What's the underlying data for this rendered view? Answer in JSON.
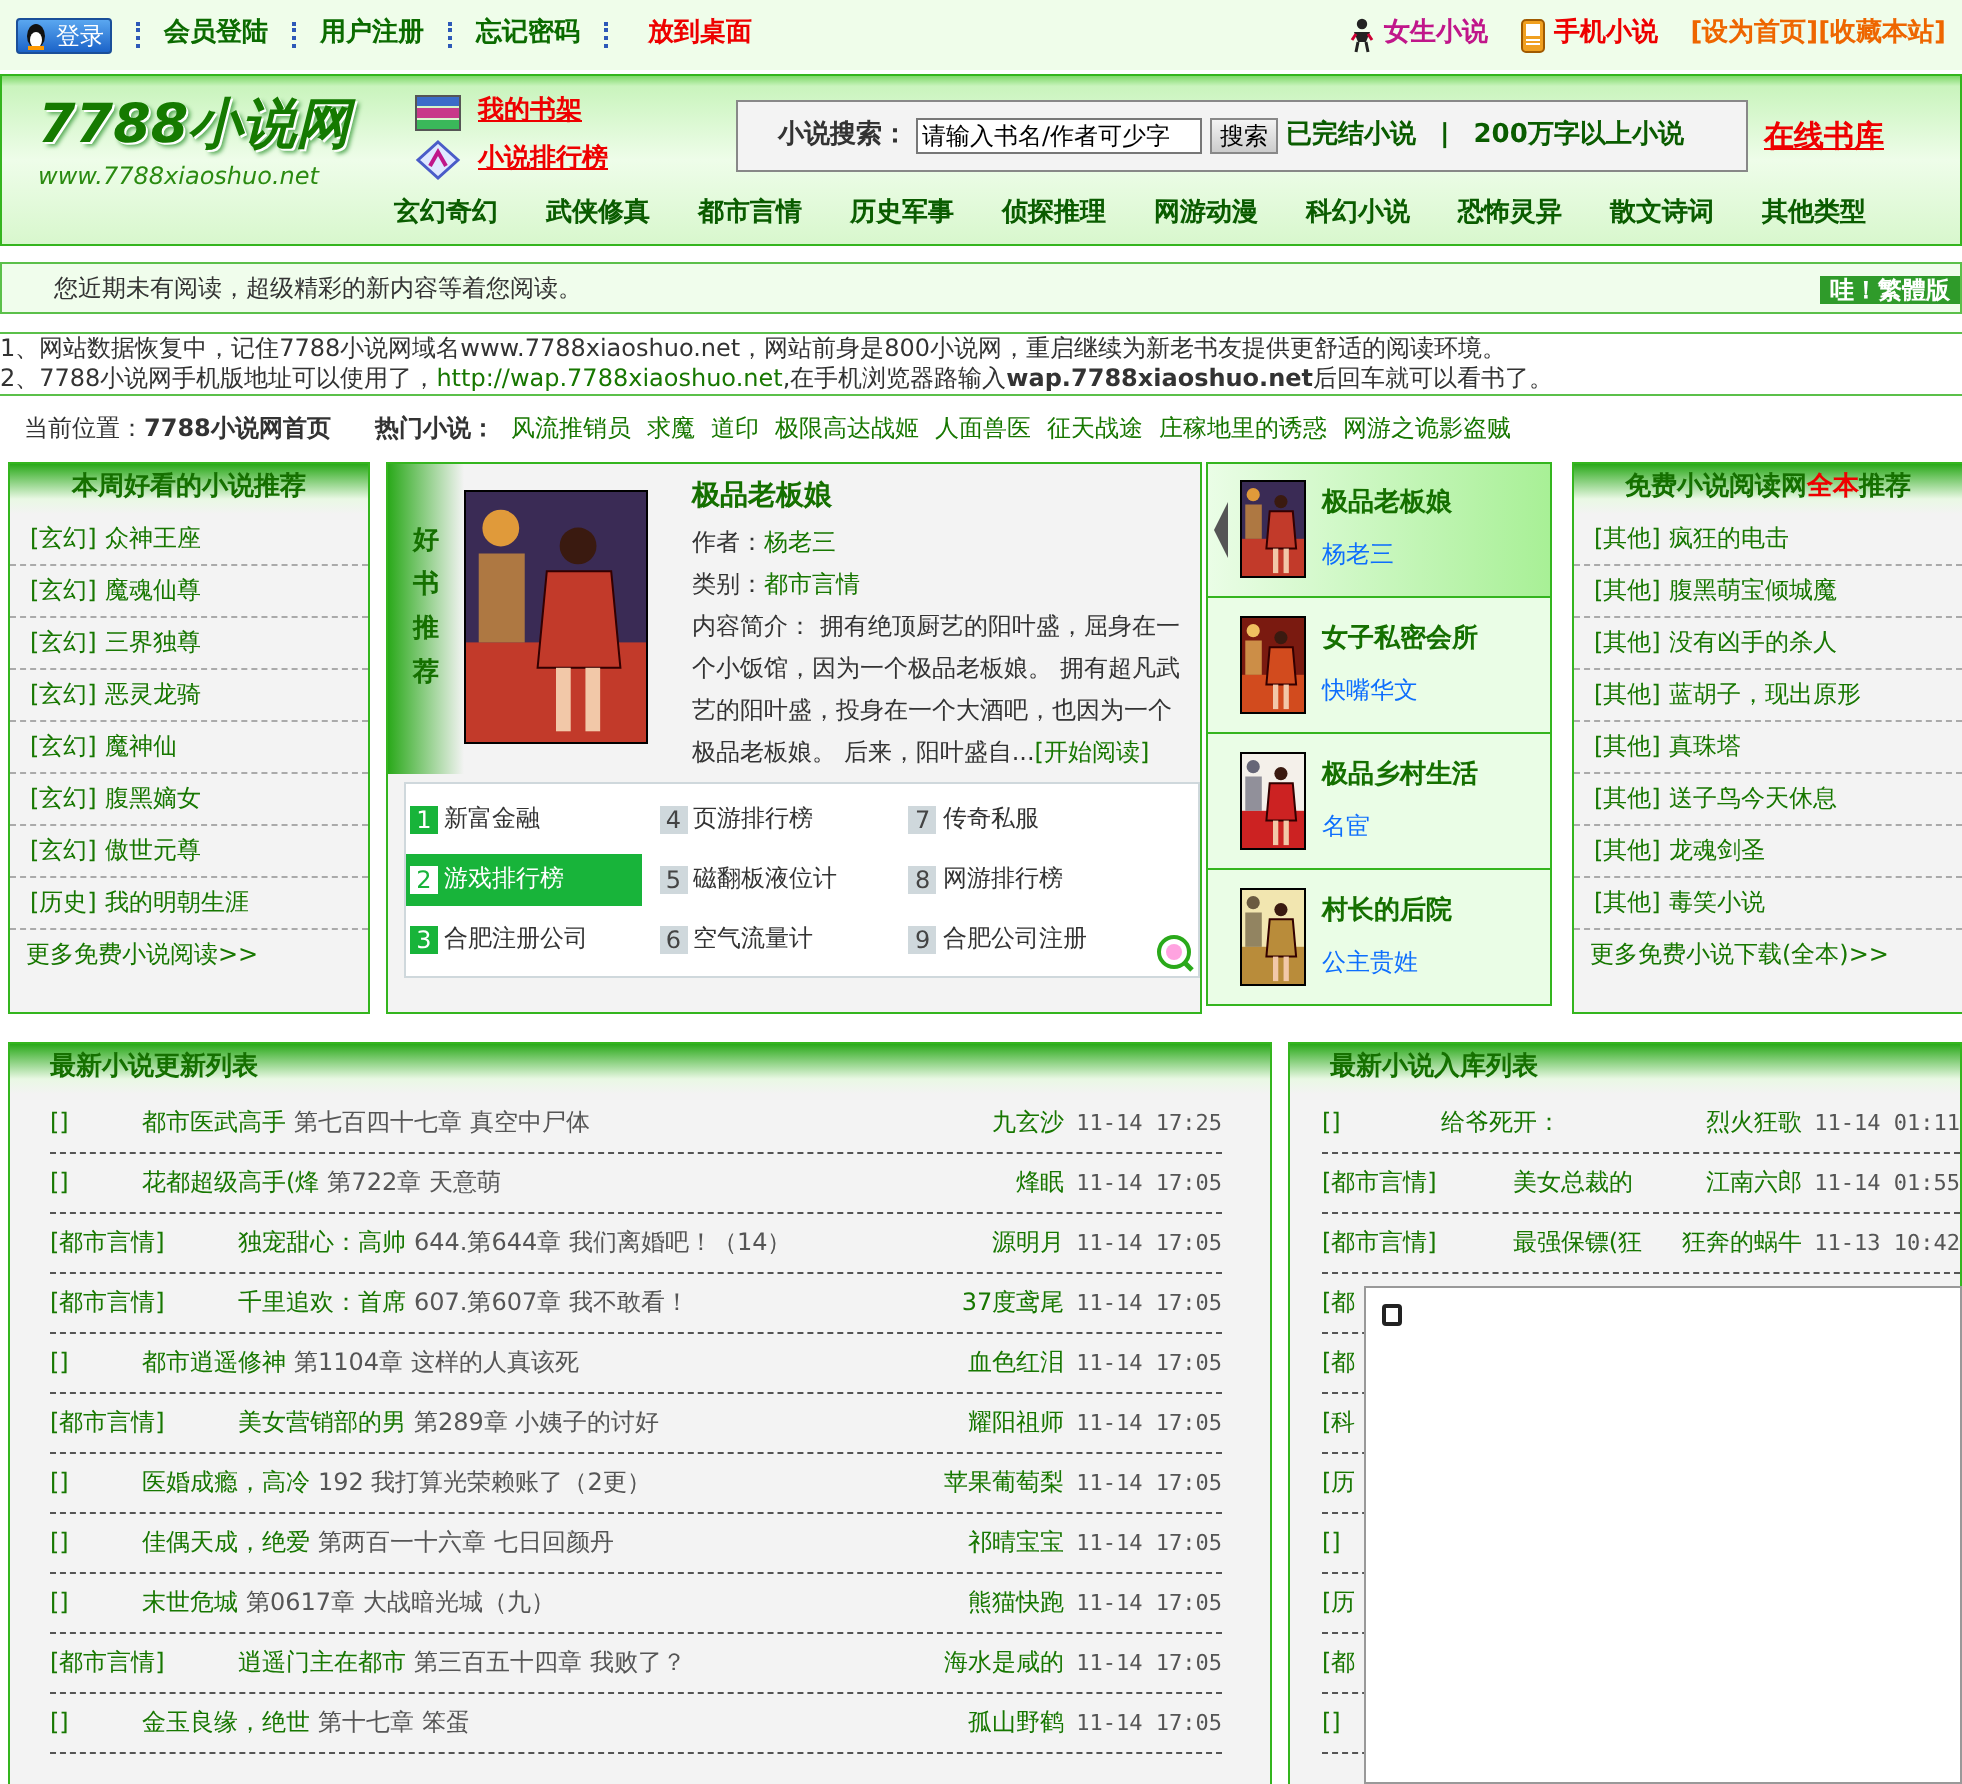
{
  "topbar": {
    "login_button": "登录",
    "links": [
      "会员登陆",
      "用户注册",
      "忘记密码"
    ],
    "desktop_link": "放到桌面",
    "right_links": [
      {
        "kind": "female",
        "label": "女生小说"
      },
      {
        "kind": "mobile",
        "label": "手机小说"
      }
    ],
    "bracket_links": [
      "[设为首页]",
      "[收藏本站]"
    ]
  },
  "header": {
    "logo": "7788小说网",
    "logo_url": "www.7788xiaoshuo.net",
    "quick_links": [
      {
        "kind": "shelf",
        "label": "我的书架"
      },
      {
        "kind": "rank",
        "label": "小说排行榜"
      }
    ],
    "search": {
      "label": "小说搜索：",
      "value": "请输入书名/作者可少字",
      "button": "搜索"
    },
    "search_links": [
      "已完结小说",
      "200万字以上小说"
    ],
    "separator": "|",
    "library_link": "在线书库",
    "categories": [
      "玄幻奇幻",
      "武侠修真",
      "都市言情",
      "历史军事",
      "侦探推理",
      "网游动漫",
      "科幻小说",
      "恐怖灵异",
      "散文诗词",
      "其他类型"
    ]
  },
  "notice": {
    "text": "您近期未有阅读，超级精彩的新内容等着您阅读。",
    "button": "哇！繁體版"
  },
  "announcements": [
    {
      "parts": [
        {
          "kind": "text",
          "text": "1、网站数据恢复中，记住7788小说网域名www.7788xiaoshuo.net，网站前身是800小说网，重启继续为新老书友提供更舒适的阅读环境。"
        }
      ]
    },
    {
      "parts": [
        {
          "kind": "text",
          "text": "2、7788小说网手机版地址可以使用了，"
        },
        {
          "kind": "link",
          "text": "http://wap.7788xiaoshuo.net"
        },
        {
          "kind": "text",
          "text": ",在手机浏览器路输入**wap.7788xiaoshuo.net**后回车就可以看书了。"
        }
      ]
    }
  ],
  "breadcrumb": {
    "label": "当前位置：",
    "current": "7788小说网首页",
    "hot_label": "热门小说：",
    "hot": [
      "风流推销员",
      "求魔",
      "道印",
      "极限高达战姬",
      "人面兽医",
      "征天战途",
      "庄稼地里的诱惑",
      "网游之诡影盗贼"
    ]
  },
  "weekly": {
    "title": "本周好看的小说推荐",
    "items": [
      {
        "cat": "[玄幻]",
        "title": "众神王座"
      },
      {
        "cat": "[玄幻]",
        "title": "魔魂仙尊"
      },
      {
        "cat": "[玄幻]",
        "title": "三界独尊"
      },
      {
        "cat": "[玄幻]",
        "title": "恶灵龙骑"
      },
      {
        "cat": "[玄幻]",
        "title": "魔神仙"
      },
      {
        "cat": "[玄幻]",
        "title": "腹黑嫡女"
      },
      {
        "cat": "[玄幻]",
        "title": "傲世元尊"
      },
      {
        "cat": "[历史]",
        "title": "我的明朝生涯"
      }
    ],
    "more": "更多免费小说阅读>>"
  },
  "featured": {
    "side": "好书推荐",
    "title": "极品老板娘",
    "author_label": "作者：",
    "author": "杨老三",
    "category_label": "类别：",
    "category": "都市言情",
    "summary": "内容简介：  拥有绝顶厨艺的阳叶盛，屈身在一个小饭馆，因为一个极品老板娘。 拥有超凡武艺的阳叶盛，投身在一个大酒吧，也因为一个极品老板娘。 后来，阳叶盛自...",
    "read_link": "[开始阅读]"
  },
  "ads": [
    {
      "num": "1",
      "label": "新富金融",
      "color": "#18b43a",
      "selected": false
    },
    {
      "num": "4",
      "label": "页游排行榜",
      "color": "#cfd8dc",
      "selected": false
    },
    {
      "num": "7",
      "label": "传奇私服",
      "color": "#cfd8dc",
      "selected": false
    },
    {
      "num": "2",
      "label": "游戏排行榜",
      "color": "#18b43a",
      "selected": true
    },
    {
      "num": "5",
      "label": "磁翻板液位计",
      "color": "#cfd8dc",
      "selected": false
    },
    {
      "num": "8",
      "label": "网游排行榜",
      "color": "#cfd8dc",
      "selected": false
    },
    {
      "num": "3",
      "label": "合肥注册公司",
      "color": "#18b43a",
      "selected": false
    },
    {
      "num": "6",
      "label": "空气流量计",
      "color": "#cfd8dc",
      "selected": false
    },
    {
      "num": "9",
      "label": "合肥公司注册",
      "color": "#cfd8dc",
      "selected": false
    }
  ],
  "thumbs": [
    {
      "title": "极品老板娘",
      "author": "杨老三",
      "selected": true
    },
    {
      "title": "女子私密会所",
      "author": "快嘴华文",
      "selected": false
    },
    {
      "title": "极品乡村生活",
      "author": "名宦",
      "selected": false
    },
    {
      "title": "村长的后院",
      "author": "公主贵姓",
      "selected": false
    }
  ],
  "full_recs": {
    "title": "免费小说阅读网",
    "title_highlight": "全本",
    "title_end": "推荐",
    "items": [
      {
        "cat": "[其他]",
        "title": "疯狂的电击"
      },
      {
        "cat": "[其他]",
        "title": "腹黑萌宝倾城魔"
      },
      {
        "cat": "[其他]",
        "title": "没有凶手的杀人"
      },
      {
        "cat": "[其他]",
        "title": "蓝胡子，现出原形"
      },
      {
        "cat": "[其他]",
        "title": "真珠塔"
      },
      {
        "cat": "[其他]",
        "title": "送子鸟今天休息"
      },
      {
        "cat": "[其他]",
        "title": "龙魂剑圣"
      },
      {
        "cat": "[其他]",
        "title": "毒笑小说"
      }
    ],
    "more": "更多免费小说下载(全本)>>"
  },
  "updates": {
    "title": "最新小说更新列表",
    "rows": [
      {
        "cat": "[]",
        "book": "都市医武高手",
        "chapter": "第七百四十七章 真空中尸体",
        "author": "九玄沙",
        "time": "11-14 17:25"
      },
      {
        "cat": "[]",
        "book": "花都超级高手(烽",
        "chapter": "第722章 天意萌",
        "author": "烽眠",
        "time": "11-14 17:05"
      },
      {
        "cat": "[都市言情]",
        "book": "独宠甜心：高帅",
        "chapter": "644.第644章 我们离婚吧！（14）",
        "author": "源明月",
        "time": "11-14 17:05"
      },
      {
        "cat": "[都市言情]",
        "book": "千里追欢：首席",
        "chapter": "607.第607章 我不敢看！",
        "author": "37度鸢尾",
        "time": "11-14 17:05"
      },
      {
        "cat": "[]",
        "book": "都市逍遥修神",
        "chapter": "第1104章 这样的人真该死",
        "author": "血色红泪",
        "time": "11-14 17:05"
      },
      {
        "cat": "[都市言情]",
        "book": "美女营销部的男",
        "chapter": "第289章 小姨子的讨好",
        "author": "耀阳祖师",
        "time": "11-14 17:05"
      },
      {
        "cat": "[]",
        "book": "医婚成瘾，高冷",
        "chapter": "192 我打算光荣赖账了（2更）",
        "author": "苹果葡萄梨",
        "time": "11-14 17:05"
      },
      {
        "cat": "[]",
        "book": "佳偶天成，绝爱",
        "chapter": "第两百一十六章 七日回颜丹",
        "author": "祁晴宝宝",
        "time": "11-14 17:05"
      },
      {
        "cat": "[]",
        "book": "末世危城",
        "chapter": "第0617章 大战暗光城（九）",
        "author": "熊猫快跑",
        "time": "11-14 17:05"
      },
      {
        "cat": "[都市言情]",
        "book": "逍遥门主在都市",
        "chapter": "第三百五十四章 我败了？",
        "author": "海水是咸的",
        "time": "11-14 17:05"
      },
      {
        "cat": "[]",
        "book": "金玉良缘，绝世",
        "chapter": "第十七章 笨蛋",
        "author": "孤山野鹤",
        "time": "11-14 17:05"
      }
    ]
  },
  "new_list": {
    "title": "最新小说入库列表",
    "rows": [
      {
        "cat": "[]",
        "book": "给爷死开：",
        "author": "烈火狂歌",
        "time": "11-14 01:11"
      },
      {
        "cat": "[都市言情]",
        "book": "美女总裁的",
        "author": "江南六郎",
        "time": "11-14 01:55"
      },
      {
        "cat": "[都市言情]",
        "book": "最强保镖(狂",
        "author": "狂奔的蜗牛",
        "time": "11-13 10:42"
      },
      {
        "cat": "[都"
      },
      {
        "cat": "[都"
      },
      {
        "cat": "[科"
      },
      {
        "cat": "[历"
      },
      {
        "cat": "[]"
      },
      {
        "cat": "[历"
      },
      {
        "cat": "[都"
      },
      {
        "cat": "[]"
      }
    ]
  }
}
